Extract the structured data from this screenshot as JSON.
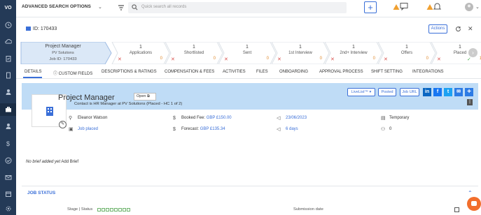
{
  "topbar": {
    "search_mode": "ADVANCED SEARCH OPTIONS",
    "search_placeholder": "Quick search all records"
  },
  "header": {
    "job_id": "ID: 170433",
    "actions_label": "Actions"
  },
  "pipeline": {
    "first": {
      "title": "Project Manager",
      "company": "PV Solutions",
      "job_id": "Job ID: 170433"
    },
    "stages": [
      {
        "count": "1",
        "label": "Applications",
        "rejected": "✕",
        "zero": "0"
      },
      {
        "count": "1",
        "label": "Shortlisted",
        "rejected": "✕",
        "zero": "0"
      },
      {
        "count": "1",
        "label": "Sent",
        "rejected": "✕",
        "zero": "0"
      },
      {
        "count": "1",
        "label": "1st Interview",
        "rejected": "✕",
        "zero": "0"
      },
      {
        "count": "1",
        "label": "2nd+ Interview",
        "rejected": "✕",
        "zero": "0"
      },
      {
        "count": "1",
        "label": "Offers",
        "rejected": "✕",
        "zero": "0"
      },
      {
        "count": "1",
        "label": "Placed",
        "rejected": "✕",
        "zero": "1"
      }
    ]
  },
  "tabs": [
    "DETAILS",
    "CUSTOM FIELDS",
    "DESCRIPTIONS & RATINGS",
    "COMPENSATION & FEES",
    "ACTIVITIES",
    "FILES",
    "ONBOARDING",
    "APPROVAL PROCESS",
    "SHIFT SETTING",
    "INTEGRATIONS"
  ],
  "job": {
    "title": "Project Manager",
    "status": "Open",
    "contact_line": "Contact is HR Manager at PV Solutions (Placed - HC 1 of 2)",
    "buttons": {
      "livelist": "LiveList™ ▾",
      "posted": "Posted",
      "job_url": "Job URL"
    },
    "social": [
      "in",
      "f",
      "t",
      "✉",
      "+"
    ],
    "owner": "Eleanor Watson",
    "type_link": "Job placed",
    "booked_fee_label": "Booked Fee:",
    "booked_fee_value": "GBP £150.00",
    "forecast_label": "Forecast:",
    "forecast_value": "GBP £135.34",
    "date": "23/06/2023",
    "days": "6 days",
    "employment": "Temporary",
    "count": "0"
  },
  "brief": {
    "text": "No brief added yet",
    "link": "Add Brief"
  },
  "job_status": {
    "title": "JOB STATUS",
    "stage_status_label": "Stage | Status",
    "submission_label": "Submission date"
  },
  "colors": {
    "sidebar": "#243a57",
    "accent": "#3a6fd8",
    "card": "#bfdcf6",
    "reject": "#d9534f",
    "zero": "#e08a2e"
  }
}
